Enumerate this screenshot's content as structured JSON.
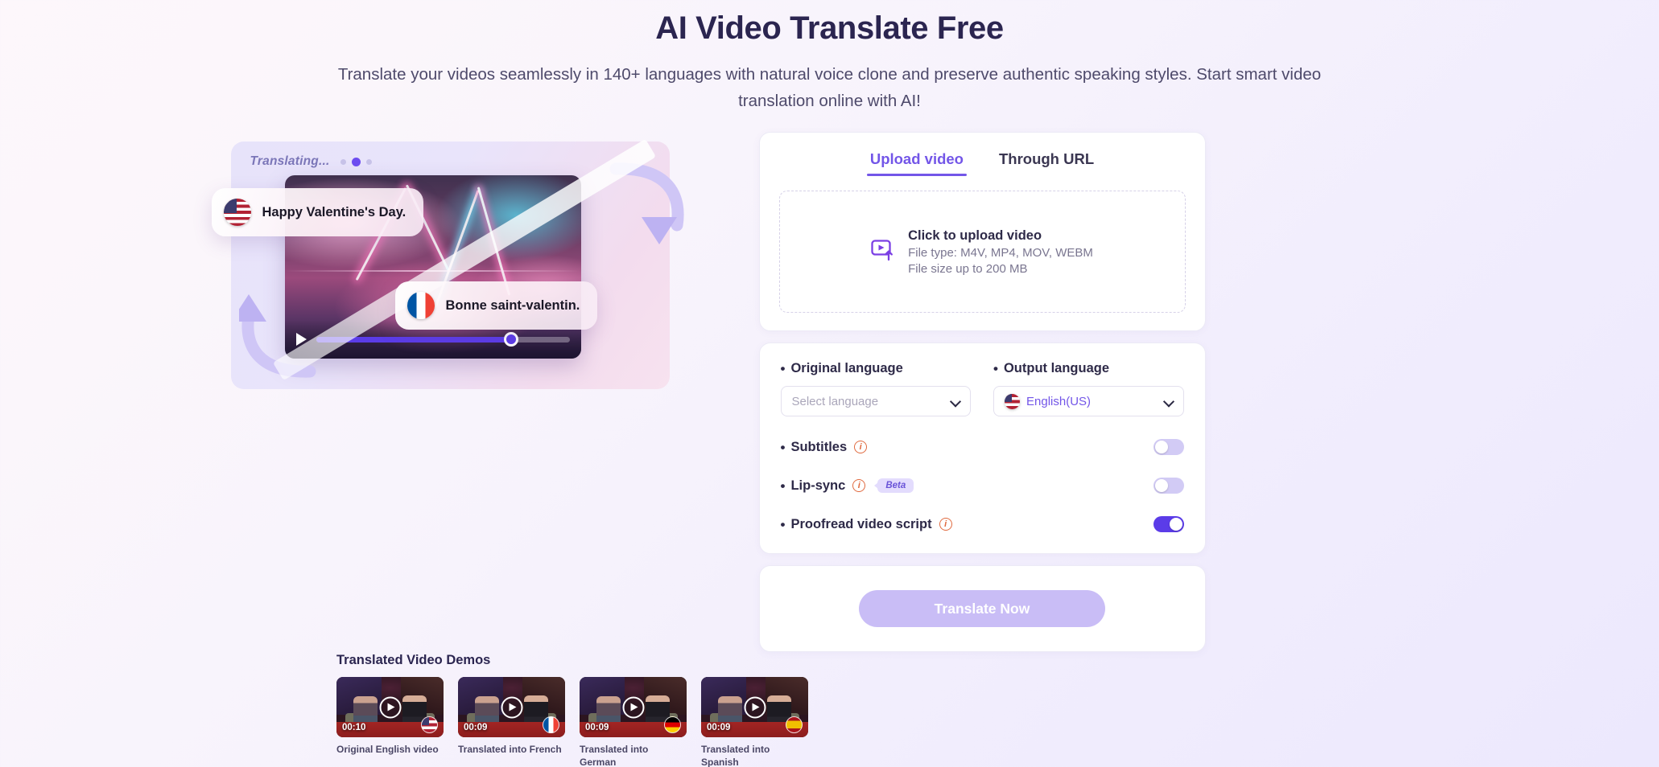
{
  "header": {
    "title": "AI Video Translate Free",
    "subtitle": "Translate your videos seamlessly in 140+ languages with natural voice clone and preserve authentic speaking styles. Start smart video translation online with AI!"
  },
  "hero": {
    "status_label": "Translating...",
    "source_bubble": {
      "flag": "us-flag-icon",
      "text": "Happy Valentine's Day."
    },
    "target_bubble": {
      "flag": "fr-flag-icon",
      "text": "Bonne saint-valentin."
    }
  },
  "upload_panel": {
    "tabs": [
      {
        "label": "Upload video",
        "active": true
      },
      {
        "label": "Through URL",
        "active": false
      }
    ],
    "dropzone": {
      "icon": "video-upload-icon",
      "title": "Click to upload video",
      "file_types": "File type: M4V, MP4, MOV, WEBM",
      "file_size": "File size up to 200 MB"
    }
  },
  "settings_panel": {
    "original_language": {
      "label": "Original language",
      "placeholder": "Select language",
      "value": ""
    },
    "output_language": {
      "label": "Output language",
      "value": "English(US)",
      "flag": "us-flag-icon"
    },
    "toggles": [
      {
        "label": "Subtitles",
        "info": true,
        "badge": null,
        "on": false
      },
      {
        "label": "Lip-sync",
        "info": true,
        "badge": "Beta",
        "on": false
      },
      {
        "label": "Proofread video script",
        "info": true,
        "badge": null,
        "on": true
      }
    ]
  },
  "action_panel": {
    "translate_label": "Translate Now",
    "disabled": true
  },
  "demos": {
    "title": "Translated Video Demos",
    "items": [
      {
        "duration": "00:10",
        "flag": "us-flag-icon",
        "caption": "Original English video"
      },
      {
        "duration": "00:09",
        "flag": "fr-flag-icon",
        "caption": "Translated into French"
      },
      {
        "duration": "00:09",
        "flag": "de-flag-icon",
        "caption": "Translated into German"
      },
      {
        "duration": "00:09",
        "flag": "es-flag-icon",
        "caption": "Translated into Spanish"
      }
    ]
  },
  "colors": {
    "brand_purple": "#7356e8",
    "accent_purple": "#5b3ce8",
    "toggle_off": "#d2cbf5",
    "info_orange": "#e06a3f",
    "title_navy": "#2b2550",
    "button_disabled": "#c9bdf6"
  }
}
